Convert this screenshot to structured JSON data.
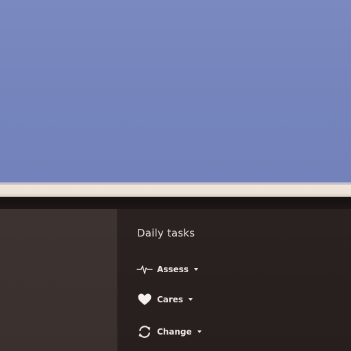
{
  "menu": {
    "title": "Daily tasks",
    "items": [
      {
        "label": "Assess",
        "icon": "heartbeat-icon"
      },
      {
        "label": "Cares",
        "icon": "heart-icon"
      },
      {
        "label": "Change",
        "icon": "refresh-icon"
      }
    ]
  },
  "colors": {
    "upper_panel": "#7584bc",
    "light_strip": "#ece1d6",
    "menu_background": "#2a2220",
    "left_panel": "#3b322f",
    "text": "#ece7e2"
  }
}
